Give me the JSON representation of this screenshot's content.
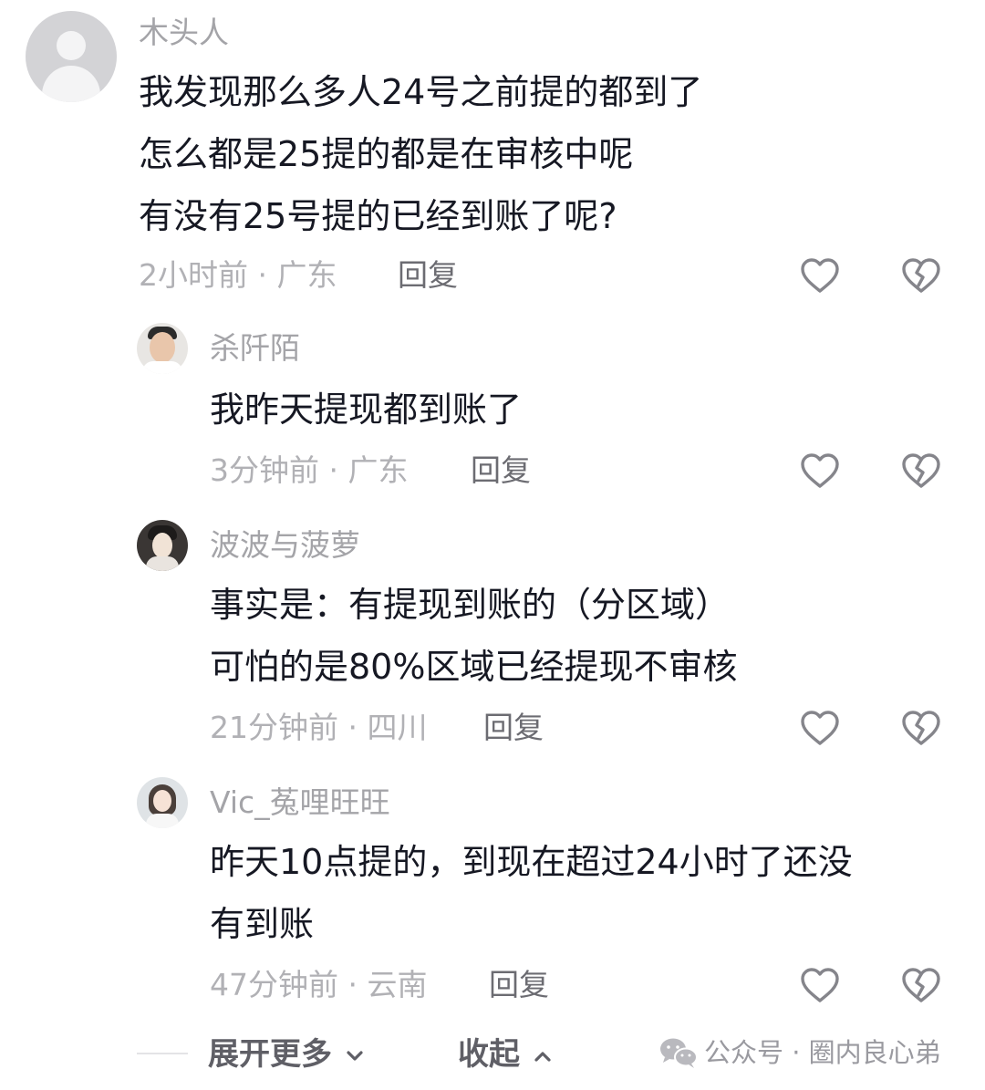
{
  "comments": [
    {
      "username": "木头人",
      "lines": [
        "我发现那么多人24号之前提的都到了",
        "怎么都是25提的都是在审核中呢",
        "有没有25号提的已经到账了呢?"
      ],
      "meta": "2小时前 · 广东",
      "reply_label": "回复"
    },
    {
      "username": "杀阡陌",
      "lines": [
        "我昨天提现都到账了"
      ],
      "meta": "3分钟前 · 广东",
      "reply_label": "回复"
    },
    {
      "username": "波波与菠萝",
      "lines": [
        "事实是：有提现到账的（分区域）",
        "可怕的是80%区域已经提现不审核"
      ],
      "meta": "21分钟前 · 四川",
      "reply_label": "回复"
    },
    {
      "username": "Vic_菟哩旺旺",
      "lines": [
        "昨天10点提的，到现在超过24小时了还没",
        "有到账"
      ],
      "meta": "47分钟前 · 云南",
      "reply_label": "回复"
    }
  ],
  "footer": {
    "expand_label": "展开更多",
    "collapse_label": "收起",
    "watermark": "公众号 · 圈内良心弟"
  },
  "icons": {
    "like": "heart-outline-icon",
    "dislike": "broken-heart-icon",
    "expand": "chevron-down-icon",
    "collapse": "chevron-up-icon",
    "watermark": "wechat-icon"
  }
}
